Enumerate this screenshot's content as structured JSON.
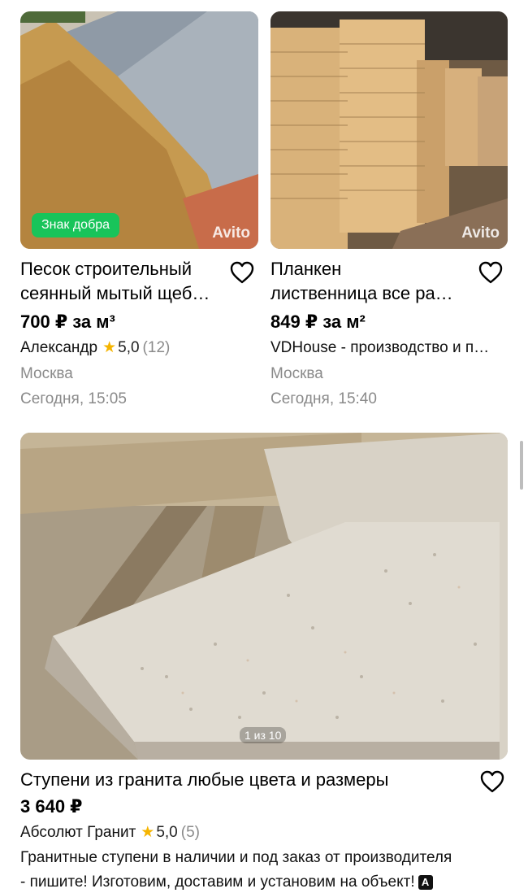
{
  "listings": [
    {
      "badge": "Знак добра",
      "watermark": "Avito",
      "title_line1": "Песок строительный",
      "title_line2": "сеянный мытый щеб…",
      "price": "700 ₽ за м³",
      "seller": "Александр",
      "rating": "5,0",
      "reviews": "(12)",
      "city": "Москва",
      "date": "Сегодня, 15:05"
    },
    {
      "watermark": "Avito",
      "title_line1": "Планкен",
      "title_line2": "лиственница все ра…",
      "price": "849 ₽ за м²",
      "seller": "VDHouse - производство и п…",
      "city": "Москва",
      "date": "Сегодня, 15:40"
    },
    {
      "counter": "1 из 10",
      "title": "Ступени из гранита любые цвета и размеры",
      "price": "3 640 ₽",
      "seller": "Абсолют Гранит",
      "rating": "5,0",
      "reviews": "(5)",
      "desc_line1": "Гранитные ступени в наличии и под заказ от производителя",
      "desc_line2": "- пишите! Изготовим, доставим и установим на объект!",
      "ai_badge": "A"
    }
  ],
  "colors": {
    "badge": "#18c45a",
    "star": "#f5b400",
    "muted": "#8a8a8a"
  },
  "icons": {
    "favorite": "heart-outline-icon",
    "star": "star-icon"
  }
}
